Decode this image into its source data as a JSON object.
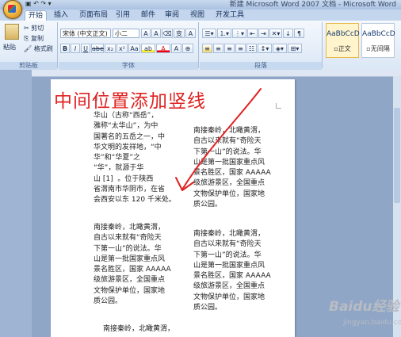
{
  "window": {
    "title": "新建 Microsoft Word 2007 文档 - Microsoft Word"
  },
  "tabs": [
    "开始",
    "插入",
    "页面布局",
    "引用",
    "邮件",
    "审阅",
    "视图",
    "开发工具"
  ],
  "clipboard": {
    "paste": "粘贴",
    "cut": "剪切",
    "copy": "复制",
    "format_painter": "格式刷",
    "label": "剪贴板"
  },
  "font": {
    "name": "宋体 (中文正文)",
    "size": "小二",
    "label": "字体",
    "glyphs": [
      "A",
      "A",
      "Aa",
      "ab",
      "A",
      "B",
      "I",
      "U",
      "abe",
      "x₂",
      "x²",
      "Aa",
      "A",
      "A",
      "A"
    ]
  },
  "paragraph": {
    "label": "段落"
  },
  "styles": {
    "items": [
      {
        "sample": "AaBbCcD",
        "name": "▫正文"
      },
      {
        "sample": "AaBbCcD",
        "name": "▫无间隔"
      }
    ]
  },
  "document": {
    "headline": "中间位置添加竖线",
    "col_left_1": "华山（古称“西岳”，\n雅称“太华山”，为中\n国著名的五岳之一，中\n华文明的发祥地，“中\n华”和“华夏”之\n“华”，就源于华\n山 [1]  。位于陕西\n省渭南市华阴市，在省\n会西安以东 120 千米处。",
    "col_right_1": "南接秦岭，北瞰黄渭，\n自古以来就有“奇险天\n下第一山”的说法。华\n山是第一批国家重点风\n景名胜区，国家 AAAAA\n级旅游景区，全国重点\n文物保护单位，国家地\n质公园。",
    "col_left_2": "南接秦岭，北瞰黄渭，\n自古以来就有“奇险天\n下第一山”的说法。华\n山是第一批国家重点风\n景名胜区，国家 AAAAA\n级旅游景区，全国重点\n文物保护单位，国家地\n质公园。",
    "col_right_2": "南接秦岭，北瞰黄渭，\n自古以来就有“奇险天\n下第一山”的说法。华\n山是第一批国家重点风\n景名胜区，国家 AAAAA\n级旅游景区，全国重点\n文物保护单位，国家地\n质公园。",
    "col_left_3": "南接秦岭，北瞰黄渭，"
  },
  "watermark": {
    "brand": "Baidu经验",
    "url": "jingyan.baidu.com"
  },
  "colors": {
    "annotation": "#e02222",
    "ribbon_bg": "#dbe7f5",
    "page_bg": "#ffffff"
  }
}
